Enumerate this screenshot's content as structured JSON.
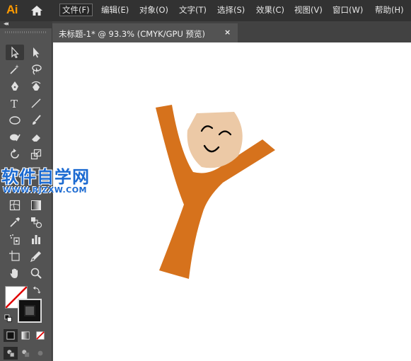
{
  "app": {
    "logo": "Ai"
  },
  "menu": [
    {
      "label": "文件(F)",
      "active": true
    },
    {
      "label": "编辑(E)"
    },
    {
      "label": "对象(O)"
    },
    {
      "label": "文字(T)"
    },
    {
      "label": "选择(S)"
    },
    {
      "label": "效果(C)"
    },
    {
      "label": "视图(V)"
    },
    {
      "label": "窗口(W)"
    },
    {
      "label": "帮助(H)"
    }
  ],
  "document_tab": {
    "label": "未标题-1* @ 93.3% (CMYK/GPU 预览)",
    "close": "×"
  },
  "toolbar": {
    "collapse": "◂◂"
  },
  "watermark": {
    "title": "软件自学网",
    "url": "WWW.RJZXW.COM"
  },
  "colors": {
    "figure": "#d6721c",
    "face": "#ecc9a6",
    "accent": "#ff9a00",
    "watermark": "#1b6ad1"
  }
}
